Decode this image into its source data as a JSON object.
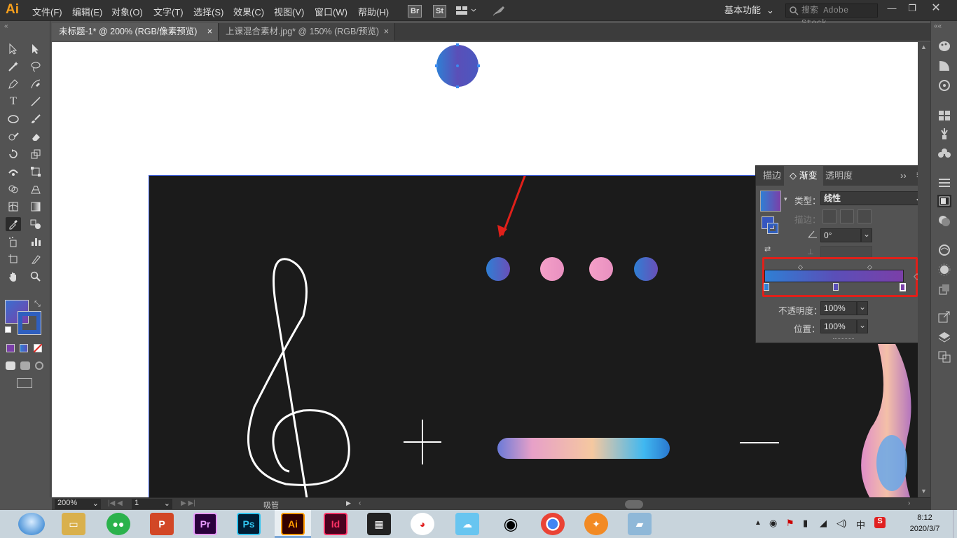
{
  "app": {
    "logo": "Ai",
    "accent": "#f7a01c"
  },
  "menu": [
    {
      "label": "文件(F)"
    },
    {
      "label": "编辑(E)"
    },
    {
      "label": "对象(O)"
    },
    {
      "label": "文字(T)"
    },
    {
      "label": "选择(S)"
    },
    {
      "label": "效果(C)"
    },
    {
      "label": "视图(V)"
    },
    {
      "label": "窗口(W)"
    },
    {
      "label": "帮助(H)"
    }
  ],
  "bridge": {
    "br": "Br",
    "st": "St"
  },
  "workspace": {
    "label": "基本功能"
  },
  "search": {
    "placeholder": "搜索 Adobe Stock"
  },
  "tabs": [
    {
      "label": "未标题-1* @ 200% (RGB/像素预览)",
      "close": "×"
    },
    {
      "label": "上课混合素材.jpg* @ 150% (RGB/预览)",
      "close": "×"
    }
  ],
  "gradient_panel": {
    "tabs": [
      {
        "label": "描边"
      },
      {
        "label": "◇ 渐变"
      },
      {
        "label": "透明度"
      }
    ],
    "type_label": "类型：",
    "type_value": "线性",
    "stroke_label": "描边：",
    "angle_value": "0°",
    "opacity_label": "不透明度：",
    "opacity_value": "100%",
    "location_label": "位置：",
    "location_value": "100%",
    "gradient_colors": {
      "start": "#2f7fd4",
      "mid": "#5a4fb8",
      "end": "#7b3fa8"
    }
  },
  "status": {
    "zoom": "200%",
    "artboard": "1",
    "tool": "吸管"
  },
  "clock": {
    "time": "8:12",
    "date": "2020/3/7"
  },
  "tray": {
    "ime": "中"
  },
  "taskbar_apps": [
    {
      "name": "pr",
      "label": "Pr"
    },
    {
      "name": "ps",
      "label": "Ps"
    },
    {
      "name": "ai",
      "label": "Ai"
    },
    {
      "name": "id",
      "label": "Id"
    }
  ]
}
